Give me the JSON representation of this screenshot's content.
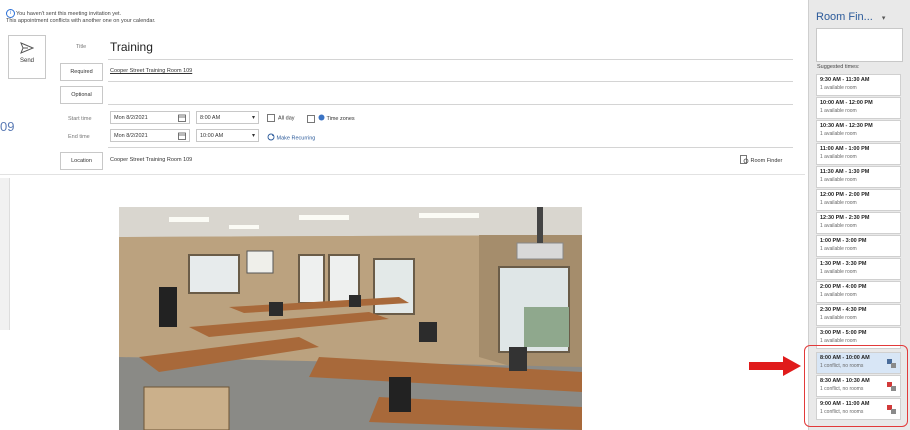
{
  "info": {
    "line1": "You haven't sent this meeting invitation yet.",
    "line2": "This appointment conflicts with another one on your calendar."
  },
  "send": {
    "label": "Send"
  },
  "form": {
    "title_label": "Title",
    "title_value": "Training",
    "required_label": "Required",
    "required_value": "Cooper Street Training Room 109",
    "optional_label": "Optional",
    "start_label": "Start time",
    "start_date": "Mon 8/2/2021",
    "start_time": "8:00 AM",
    "end_label": "End time",
    "end_date": "Mon 8/2/2021",
    "end_time": "10:00 AM",
    "all_day": "All day",
    "time_zones": "Time zones",
    "make_recurring": "Make Recurring",
    "location_label": "Location",
    "location_value": "Cooper Street Training Room 109",
    "room_finder": "Room Finder"
  },
  "left_cut_text": "09",
  "panel": {
    "title": "Room Fin...",
    "suggested_label": "Suggested times:",
    "slots": [
      {
        "time": "9:30 AM - 11:30 AM",
        "status": "1 available room"
      },
      {
        "time": "10:00 AM - 12:00 PM",
        "status": "1 available room"
      },
      {
        "time": "10:30 AM - 12:30 PM",
        "status": "1 available room"
      },
      {
        "time": "11:00 AM - 1:00 PM",
        "status": "1 available room"
      },
      {
        "time": "11:30 AM - 1:30 PM",
        "status": "1 available room"
      },
      {
        "time": "12:00 PM - 2:00 PM",
        "status": "1 available room"
      },
      {
        "time": "12:30 PM - 2:30 PM",
        "status": "1 available room"
      },
      {
        "time": "1:00 PM - 3:00 PM",
        "status": "1 available room"
      },
      {
        "time": "1:30 PM - 3:30 PM",
        "status": "1 available room"
      },
      {
        "time": "2:00 PM - 4:00 PM",
        "status": "1 available room"
      },
      {
        "time": "2:30 PM - 4:30 PM",
        "status": "1 available room"
      },
      {
        "time": "3:00 PM - 5:00 PM",
        "status": "1 available room"
      },
      {
        "time": "8:00 AM - 10:00 AM",
        "status": "1 conflict, no rooms"
      },
      {
        "time": "8:30 AM - 10:30 AM",
        "status": "1 conflict, no rooms"
      },
      {
        "time": "9:00 AM - 11:00 AM",
        "status": "1 conflict, no rooms"
      }
    ]
  },
  "colors": {
    "accent": "#2b5a9a",
    "highlight": "#e23a3a",
    "selected_slot": "#d8e6f6"
  }
}
